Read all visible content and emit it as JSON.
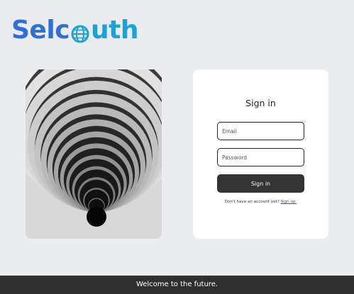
{
  "brand": {
    "logo_part1": "Sel",
    "logo_part2": "uth",
    "logo_colors": {
      "primary": "#2e6fd8",
      "secondary": "#1aa3d9"
    }
  },
  "hero": {
    "image": "concentric-spiral-staircase"
  },
  "signin": {
    "title": "Sign in",
    "email_placeholder": "Email",
    "password_placeholder": "Password",
    "button_label": "Sign in",
    "signup_prompt": "Don't have an account yet?",
    "signup_link": "Sign up."
  },
  "footer": {
    "text": "Welcome to the future."
  },
  "colors": {
    "background": "#ebecef",
    "button": "#333333",
    "link": "#5b2bc7",
    "footer": "#2f2f2f"
  }
}
